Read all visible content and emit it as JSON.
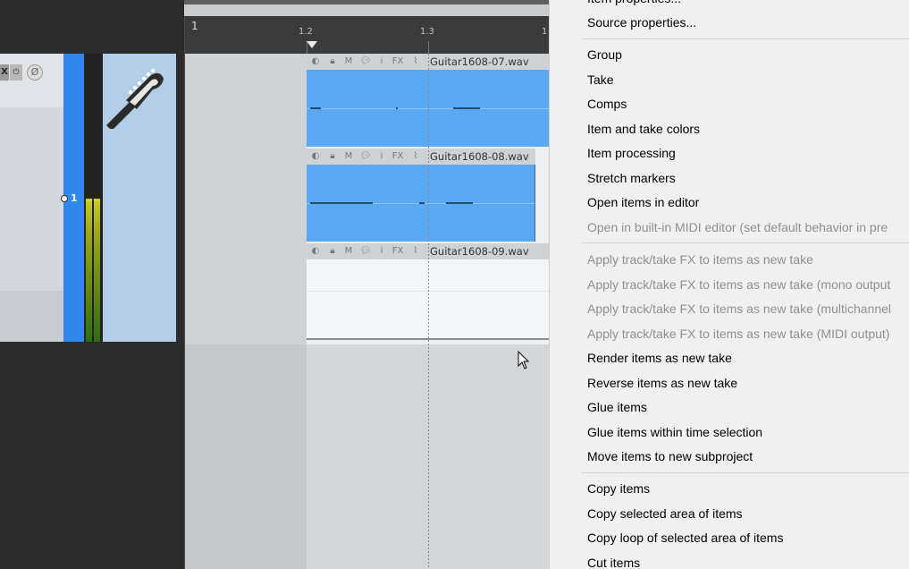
{
  "tcp": {
    "fx_label": "X",
    "power_glyph": "⏻",
    "phase_glyph": "Ø",
    "track_number": "1",
    "track_icon": "guitar-headstock-icon"
  },
  "arrange": {
    "ruler": {
      "labels": [
        "1",
        "1.2",
        "1.3",
        "1"
      ]
    },
    "items": [
      {
        "name": "Guitar1608-07.wav",
        "icons": [
          "FX"
        ]
      },
      {
        "name": "Guitar1608-08.wav",
        "icons": [
          "FX"
        ]
      },
      {
        "name": "Guitar1608-09.wav",
        "icons": [
          "FX"
        ]
      }
    ],
    "item_button_glyphs": {
      "mute": "M",
      "info": "i",
      "fx": "FX"
    },
    "colors": {
      "item_waveform": "#5aa8f2",
      "selected_track": "#2e88ee"
    }
  },
  "menu": {
    "items": [
      {
        "label": "Item properties...",
        "disabled": false
      },
      {
        "label": "Source properties...",
        "disabled": false
      },
      {
        "label": "Group",
        "disabled": false
      },
      {
        "label": "Take",
        "disabled": false
      },
      {
        "label": "Comps",
        "disabled": false
      },
      {
        "label": "Item and take colors",
        "disabled": false
      },
      {
        "label": "Item processing",
        "disabled": false
      },
      {
        "label": "Stretch markers",
        "disabled": false
      },
      {
        "label": "Open items in editor",
        "disabled": false
      },
      {
        "label": "Open in built-in MIDI editor (set default behavior in pre",
        "disabled": true
      },
      {
        "label": "Apply track/take FX to items as new take",
        "disabled": true
      },
      {
        "label": "Apply track/take FX to items as new take (mono output",
        "disabled": true
      },
      {
        "label": "Apply track/take FX to items as new take (multichannel",
        "disabled": true
      },
      {
        "label": "Apply track/take FX to items as new take (MIDI output)",
        "disabled": true
      },
      {
        "label": "Render items as new take",
        "disabled": false
      },
      {
        "label": "Reverse items as new take",
        "disabled": false
      },
      {
        "label": "Glue items",
        "disabled": false
      },
      {
        "label": "Glue items within time selection",
        "disabled": false
      },
      {
        "label": "Move items to new subproject",
        "disabled": false
      },
      {
        "label": "Copy items",
        "disabled": false
      },
      {
        "label": "Copy selected area of items",
        "disabled": false
      },
      {
        "label": "Copy loop of selected area of items",
        "disabled": false
      },
      {
        "label": "Cut items",
        "disabled": false
      }
    ]
  }
}
